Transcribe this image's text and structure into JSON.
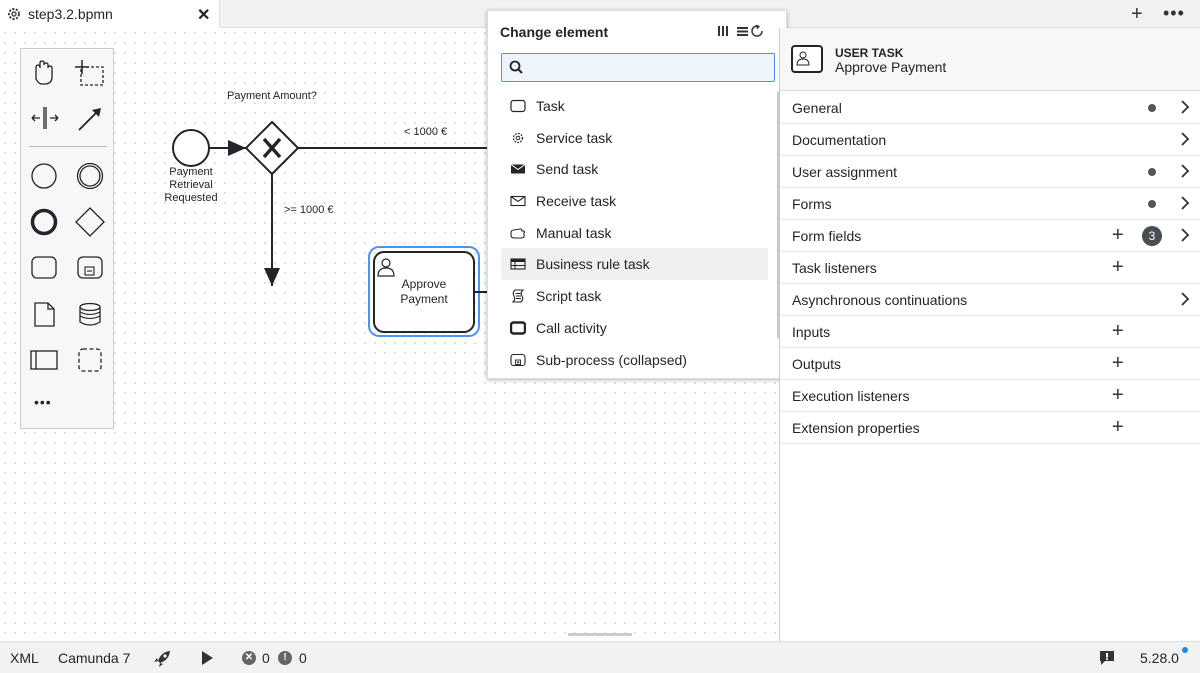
{
  "tabs": {
    "active_title": "step3.2.bpmn",
    "close_glyph": "✕",
    "add_glyph": "+",
    "more_glyph": "•••"
  },
  "diagram": {
    "gateway_label": "Payment Amount?",
    "start_event_label_line1": "Payment",
    "start_event_label_line2": "Retrieval",
    "start_event_label_line3": "Requested",
    "flow_low_label": "< 1000 €",
    "flow_high_label": ">= 1000 €",
    "task_label_line1": "Approve",
    "task_label_line2": "Payment",
    "selection_color": "#4d90ff"
  },
  "palette": {
    "tools": [
      "hand-tool",
      "lasso-tool",
      "space-tool",
      "connect-tool"
    ],
    "shapes": [
      "start-event",
      "intermediate-event",
      "end-event",
      "gateway",
      "task",
      "subprocess",
      "data-object",
      "data-store",
      "pool",
      "group"
    ],
    "more_glyph": "•••"
  },
  "popup": {
    "title": "Change element",
    "search_placeholder": "",
    "items": [
      {
        "label": "Task",
        "icon": "task-icon"
      },
      {
        "label": "Service task",
        "icon": "service-task-icon"
      },
      {
        "label": "Send task",
        "icon": "send-task-icon"
      },
      {
        "label": "Receive task",
        "icon": "receive-task-icon"
      },
      {
        "label": "Manual task",
        "icon": "manual-task-icon"
      },
      {
        "label": "Business rule task",
        "icon": "business-rule-task-icon"
      },
      {
        "label": "Script task",
        "icon": "script-task-icon"
      },
      {
        "label": "Call activity",
        "icon": "call-activity-icon"
      },
      {
        "label": "Sub-process (collapsed)",
        "icon": "subprocess-collapsed-icon"
      }
    ],
    "highlighted_item": "Business rule task"
  },
  "properties": {
    "element_type": "USER TASK",
    "element_name": "Approve Payment",
    "groups": [
      {
        "label": "General",
        "dot": true,
        "chevron": true
      },
      {
        "label": "Documentation",
        "chevron": true
      },
      {
        "label": "User assignment",
        "dot": true,
        "chevron": true
      },
      {
        "label": "Forms",
        "dot": true,
        "chevron": true
      },
      {
        "label": "Form fields",
        "plus": true,
        "badge": "3",
        "chevron": true
      },
      {
        "label": "Task listeners",
        "plus": true
      },
      {
        "label": "Asynchronous continuations",
        "chevron": true
      },
      {
        "label": "Inputs",
        "plus": true
      },
      {
        "label": "Outputs",
        "plus": true
      },
      {
        "label": "Execution listeners",
        "plus": true
      },
      {
        "label": "Extension properties",
        "plus": true
      }
    ]
  },
  "statusbar": {
    "xml": "XML",
    "platform": "Camunda 7",
    "errors": "0",
    "warnings": "0",
    "version": "5.28.0"
  }
}
